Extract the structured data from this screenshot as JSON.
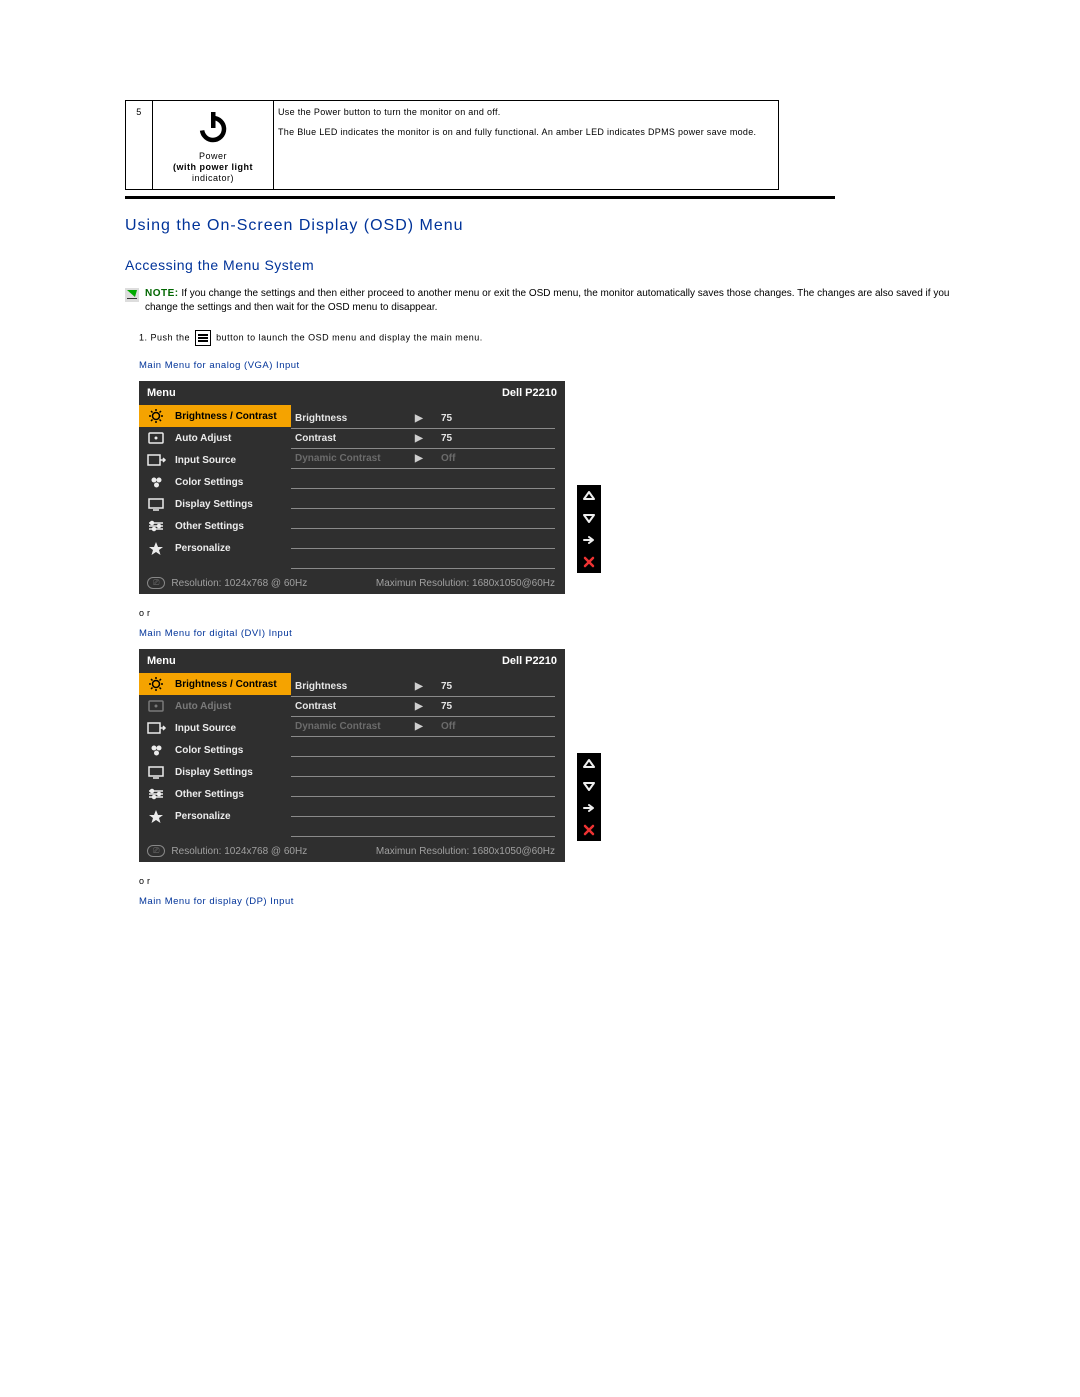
{
  "table_row": {
    "num": "5",
    "icon_block": {
      "line1": "Power",
      "line2": "(with power light",
      "line3": "indicator)"
    },
    "desc_p1": "Use the Power button to turn the monitor on and off.",
    "desc_p2": "The Blue LED indicates the monitor is on and fully functional. An amber LED indicates DPMS power save mode."
  },
  "heading_osd": "Using the On-Screen Display (OSD) Menu",
  "heading_access": "Accessing the Menu System",
  "note": {
    "label": "NOTE:",
    "text": " If you change the settings and then either proceed to another menu or exit the OSD menu, the monitor automatically saves those changes. The changes are also saved if you change the settings and then wait for the OSD menu to disappear."
  },
  "step1_pre": "1. Push the ",
  "step1_post": " button to launch the OSD menu and display the main menu.",
  "caption_vga": "Main Menu for analog (VGA) Input",
  "caption_dvi": "Main Menu for digital (DVI) Input",
  "caption_dp": "Main Menu for display (DP) Input",
  "or_text": "or",
  "osd_common": {
    "menu_label": "Menu",
    "model": "Dell P2210",
    "left_items": [
      "Brightness / Contrast",
      "Auto Adjust",
      "Input Source",
      "Color Settings",
      "Display Settings",
      "Other Settings",
      "Personalize"
    ],
    "rows": [
      {
        "label": "Brightness",
        "val": "75",
        "dim": false
      },
      {
        "label": "Contrast",
        "val": "75",
        "dim": false
      },
      {
        "label": "Dynamic Contrast",
        "val": "Off",
        "dim": true
      }
    ],
    "footer_res": "Resolution: 1024x768 @ 60Hz",
    "footer_max": "Maximun Resolution: 1680x1050@60Hz"
  },
  "osd_vga": {
    "auto_adjust_dim": false
  },
  "osd_dvi": {
    "auto_adjust_dim": true
  }
}
